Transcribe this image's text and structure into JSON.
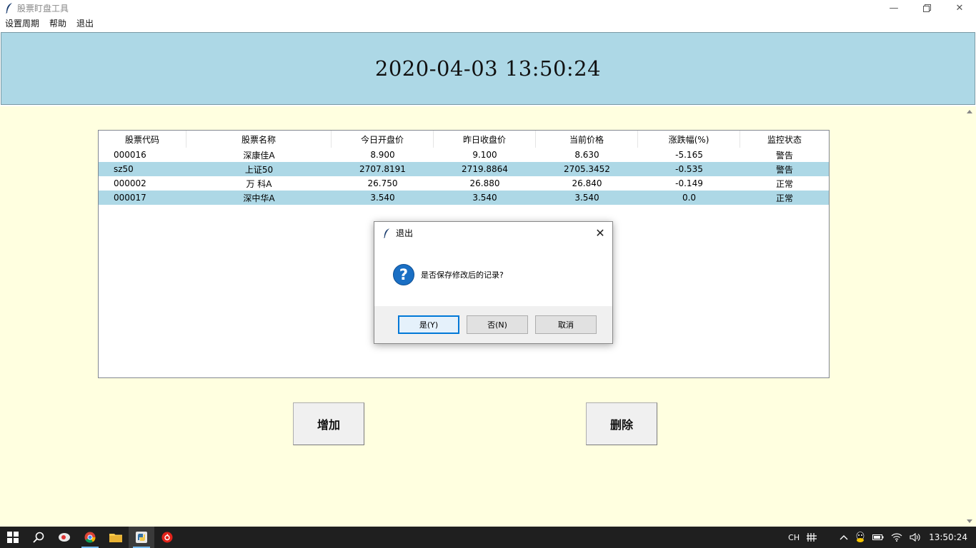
{
  "window": {
    "title": "股票盯盘工具"
  },
  "menu": [
    {
      "label": "设置周期"
    },
    {
      "label": "帮助"
    },
    {
      "label": "退出"
    }
  ],
  "clock": {
    "text": "2020-04-03 13:50:24"
  },
  "table": {
    "headers": [
      "股票代码",
      "股票名称",
      "今日开盘价",
      "昨日收盘价",
      "当前价格",
      "涨跌幅(%)",
      "监控状态"
    ],
    "rows": [
      [
        "000016",
        "深康佳A",
        "8.900",
        "9.100",
        "8.630",
        "-5.165",
        "警告"
      ],
      [
        "sz50",
        "上证50",
        "2707.8191",
        "2719.8864",
        "2705.3452",
        "-0.535",
        "警告"
      ],
      [
        "000002",
        "万 科A",
        "26.750",
        "26.880",
        "26.840",
        "-0.149",
        "正常"
      ],
      [
        "000017",
        "深中华A",
        "3.540",
        "3.540",
        "3.540",
        "0.0",
        "正常"
      ]
    ]
  },
  "buttons": {
    "add": "增加",
    "delete": "删除"
  },
  "dialog": {
    "title": "退出",
    "message": "是否保存修改后的记录?",
    "yes": "是(Y)",
    "no": "否(N)",
    "cancel": "取消"
  },
  "taskbar": {
    "ime": "CH",
    "clock": "13:50:24"
  },
  "colors": {
    "banner": "#add8e6",
    "main_bg": "#ffffe0",
    "row_alt": "#add8e6",
    "question_icon": "#1a6fc4"
  }
}
